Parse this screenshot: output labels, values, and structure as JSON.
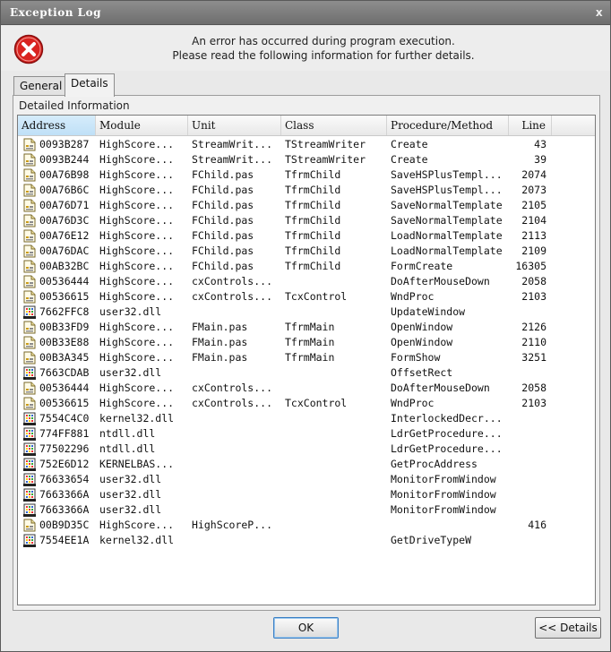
{
  "window": {
    "title": "Exception Log",
    "close_glyph": "x"
  },
  "header": {
    "icon": "error-icon",
    "line1": "An error has occurred during program execution.",
    "line2": "Please read the following information for further details."
  },
  "tabs": [
    {
      "label": "General",
      "active": false
    },
    {
      "label": "Details",
      "active": true
    }
  ],
  "panel": {
    "label": "Detailed Information"
  },
  "columns": [
    "Address",
    "Module",
    "Unit",
    "Class",
    "Procedure/Method",
    "Line"
  ],
  "rows": [
    {
      "icon": "unit-icon",
      "cells": [
        "0093B287",
        "HighScore...",
        "StreamWrit...",
        "TStreamWriter",
        "Create",
        "43"
      ]
    },
    {
      "icon": "unit-icon",
      "cells": [
        "0093B244",
        "HighScore...",
        "StreamWrit...",
        "TStreamWriter",
        "Create",
        "39"
      ]
    },
    {
      "icon": "unit-icon",
      "cells": [
        "00A76B98",
        "HighScore...",
        "FChild.pas",
        "TfrmChild",
        "SaveHSPlusTempl...",
        "2074"
      ]
    },
    {
      "icon": "unit-icon",
      "cells": [
        "00A76B6C",
        "HighScore...",
        "FChild.pas",
        "TfrmChild",
        "SaveHSPlusTempl...",
        "2073"
      ]
    },
    {
      "icon": "unit-icon",
      "cells": [
        "00A76D71",
        "HighScore...",
        "FChild.pas",
        "TfrmChild",
        "SaveNormalTemplate",
        "2105"
      ]
    },
    {
      "icon": "unit-icon",
      "cells": [
        "00A76D3C",
        "HighScore...",
        "FChild.pas",
        "TfrmChild",
        "SaveNormalTemplate",
        "2104"
      ]
    },
    {
      "icon": "unit-icon",
      "cells": [
        "00A76E12",
        "HighScore...",
        "FChild.pas",
        "TfrmChild",
        "LoadNormalTemplate",
        "2113"
      ]
    },
    {
      "icon": "unit-icon",
      "cells": [
        "00A76DAC",
        "HighScore...",
        "FChild.pas",
        "TfrmChild",
        "LoadNormalTemplate",
        "2109"
      ]
    },
    {
      "icon": "unit-icon",
      "cells": [
        "00AB32BC",
        "HighScore...",
        "FChild.pas",
        "TfrmChild",
        "FormCreate",
        "16305"
      ]
    },
    {
      "icon": "unit-icon",
      "cells": [
        "00536444",
        "HighScore...",
        "cxControls...",
        "",
        "DoAfterMouseDown",
        "2058"
      ]
    },
    {
      "icon": "unit-icon",
      "cells": [
        "00536615",
        "HighScore...",
        "cxControls...",
        "TcxControl",
        "WndProc",
        "2103"
      ]
    },
    {
      "icon": "dll-icon",
      "cells": [
        "7662FFC8",
        "user32.dll",
        "",
        "",
        "UpdateWindow",
        ""
      ]
    },
    {
      "icon": "unit-icon",
      "cells": [
        "00B33FD9",
        "HighScore...",
        "FMain.pas",
        "TfrmMain",
        "OpenWindow",
        "2126"
      ]
    },
    {
      "icon": "unit-icon",
      "cells": [
        "00B33E88",
        "HighScore...",
        "FMain.pas",
        "TfrmMain",
        "OpenWindow",
        "2110"
      ]
    },
    {
      "icon": "unit-icon",
      "cells": [
        "00B3A345",
        "HighScore...",
        "FMain.pas",
        "TfrmMain",
        "FormShow",
        "3251"
      ]
    },
    {
      "icon": "dll-icon",
      "cells": [
        "7663CDAB",
        "user32.dll",
        "",
        "",
        "OffsetRect",
        ""
      ]
    },
    {
      "icon": "unit-icon",
      "cells": [
        "00536444",
        "HighScore...",
        "cxControls...",
        "",
        "DoAfterMouseDown",
        "2058"
      ]
    },
    {
      "icon": "unit-icon",
      "cells": [
        "00536615",
        "HighScore...",
        "cxControls...",
        "TcxControl",
        "WndProc",
        "2103"
      ]
    },
    {
      "icon": "dll-icon",
      "cells": [
        "7554C4C0",
        "kernel32.dll",
        "",
        "",
        "InterlockedDecr...",
        ""
      ]
    },
    {
      "icon": "dll-icon",
      "cells": [
        "774FF881",
        "ntdll.dll",
        "",
        "",
        "LdrGetProcedure...",
        ""
      ]
    },
    {
      "icon": "dll-icon",
      "cells": [
        "77502296",
        "ntdll.dll",
        "",
        "",
        "LdrGetProcedure...",
        ""
      ]
    },
    {
      "icon": "dll-icon",
      "cells": [
        "752E6D12",
        "KERNELBAS...",
        "",
        "",
        "GetProcAddress",
        ""
      ]
    },
    {
      "icon": "dll-icon",
      "cells": [
        "76633654",
        "user32.dll",
        "",
        "",
        "MonitorFromWindow",
        ""
      ]
    },
    {
      "icon": "dll-icon",
      "cells": [
        "7663366A",
        "user32.dll",
        "",
        "",
        "MonitorFromWindow",
        ""
      ]
    },
    {
      "icon": "dll-icon",
      "cells": [
        "7663366A",
        "user32.dll",
        "",
        "",
        "MonitorFromWindow",
        ""
      ]
    },
    {
      "icon": "unit-icon",
      "cells": [
        "00B9D35C",
        "HighScore...",
        "HighScoreP...",
        "",
        "",
        "416"
      ]
    },
    {
      "icon": "dll-icon",
      "cells": [
        "7554EE1A",
        "kernel32.dll",
        "",
        "",
        "GetDriveTypeW",
        ""
      ]
    }
  ],
  "buttons": {
    "ok": "OK",
    "details": "<< Details"
  },
  "colors": {
    "error_red": "#d9231f",
    "selected_header": "#cfe7f8",
    "accent_blue": "#3b7fc4"
  }
}
